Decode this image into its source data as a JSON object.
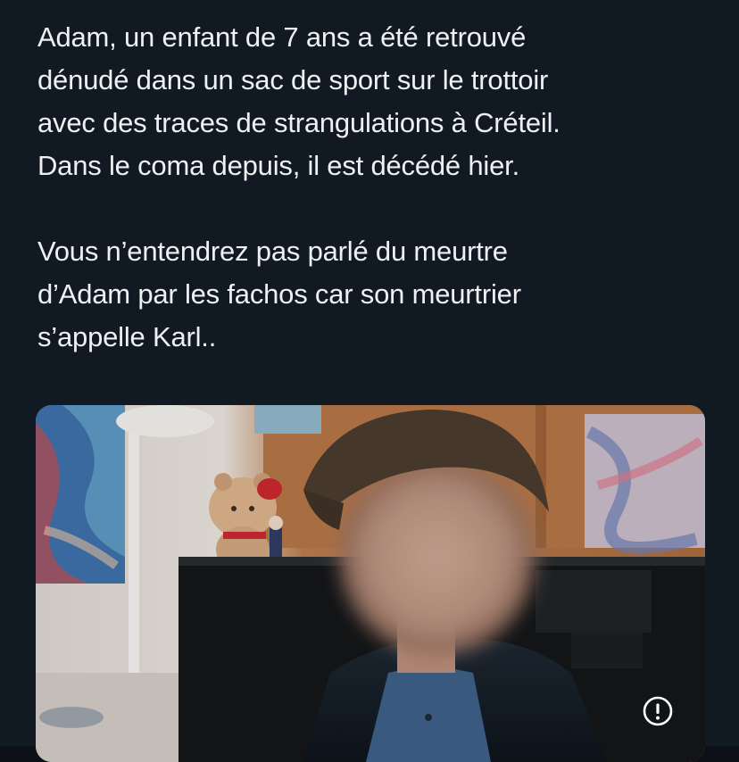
{
  "tweet": {
    "paragraph_1_lines": [
      "Adam, un enfant de 7 ans a été retrouvé",
      "dénudé dans un sac de sport sur le trottoir",
      "avec des traces de strangulations à Créteil.",
      "Dans le coma depuis, il est décédé hier."
    ],
    "paragraph_2_lines": [
      "Vous n’entendrez pas parlé du meurtre",
      "d’Adam par les fachos car son meurtrier",
      "s’appelle Karl.."
    ]
  },
  "media": {
    "icon": "alert-circle-icon",
    "colors": {
      "background": "#111923",
      "text": "#eef0f2"
    }
  }
}
